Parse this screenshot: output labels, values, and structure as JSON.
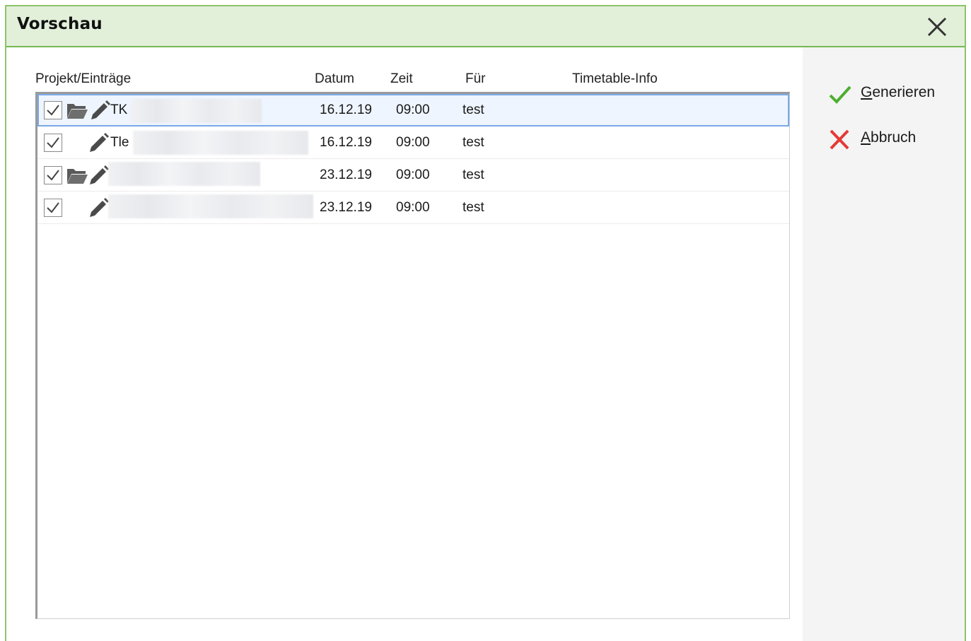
{
  "dialog": {
    "title": "Vorschau"
  },
  "table": {
    "columns": [
      "Projekt/Einträge",
      "Datum",
      "Zeit",
      "Für",
      "Timetable-Info"
    ],
    "rows": [
      {
        "checked": true,
        "has_folder": true,
        "name": "TK",
        "datum": "16.12.19",
        "zeit": "09:00",
        "fuer": "test",
        "info": ""
      },
      {
        "checked": true,
        "has_folder": false,
        "name": "Tle",
        "datum": "16.12.19",
        "zeit": "09:00",
        "fuer": "test",
        "info": ""
      },
      {
        "checked": true,
        "has_folder": true,
        "name": "",
        "datum": "23.12.19",
        "zeit": "09:00",
        "fuer": "test",
        "info": ""
      },
      {
        "checked": true,
        "has_folder": false,
        "name": "",
        "datum": "23.12.19",
        "zeit": "09:00",
        "fuer": "test",
        "info": ""
      }
    ]
  },
  "actions": {
    "generate_first": "G",
    "generate_rest": "enerieren",
    "cancel_first": "A",
    "cancel_rest": "bbruch"
  },
  "colors": {
    "titlebar_bg": "#e2efd9",
    "border_green": "#76b852",
    "check_green": "#4caf2f",
    "cancel_red": "#e53935",
    "selection_border": "#7aa9e6"
  },
  "icons": [
    "close-icon",
    "checkbox-checked-icon",
    "folder-open-icon",
    "pencil-icon",
    "checkmark-icon",
    "x-icon"
  ]
}
